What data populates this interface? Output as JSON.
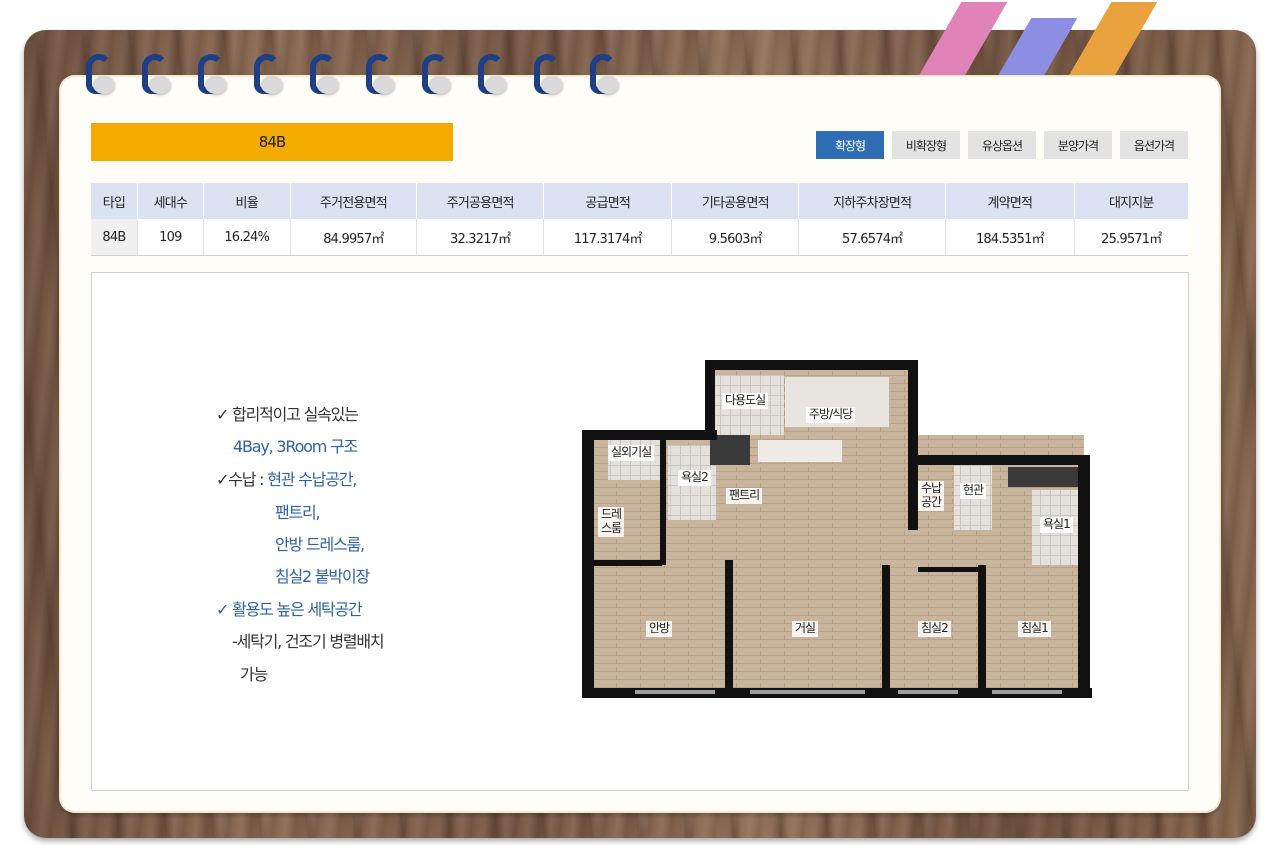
{
  "type_title": "84B",
  "buttons": [
    "확장형",
    "비확장형",
    "유상옵션",
    "분양가격",
    "옵션가격"
  ],
  "table": {
    "headers": [
      "타입",
      "세대수",
      "비율",
      "주거전용면적",
      "주거공용면적",
      "공급면적",
      "기타공용면적",
      "지하주차장면적",
      "계약면적",
      "대지지분"
    ],
    "row": [
      "84B",
      "109",
      "16.24%",
      "84.9957㎡",
      "32.3217㎡",
      "117.3174㎡",
      "9.5603㎡",
      "57.6574㎡",
      "184.5351㎡",
      "25.9571㎡"
    ]
  },
  "features": {
    "line1": "✓ 합리적이고 실속있는",
    "line2": "4Bay, 3Room 구조",
    "line3_prefix": "✓수납 :",
    "line3_value": "현관 수납공간,",
    "line4": "팬트리,",
    "line5": "안방 드레스룸,",
    "line6": "침실2 붙박이장",
    "line7": "✓ 활용도 높은 세탁공간",
    "line8": "-세탁기, 건조기 병렬배치",
    "line9": "가능"
  },
  "rooms": {
    "dayongdosil": "다용도실",
    "kitchen": "주방/식당",
    "outdoor": "실외기실",
    "bath2": "욕실2",
    "pantry": "팬트리",
    "storage": "수납\n공간",
    "entrance": "현관",
    "dress": "드레\n스룸",
    "bath1": "욕실1",
    "master": "안방",
    "living": "거실",
    "bed2": "침실2",
    "bed1": "침실1"
  },
  "colors": {
    "accent": "#f4ab00",
    "active_button": "#2f6db3",
    "header_bg": "#dbe3f2",
    "highlight_text": "#2d62a8"
  }
}
